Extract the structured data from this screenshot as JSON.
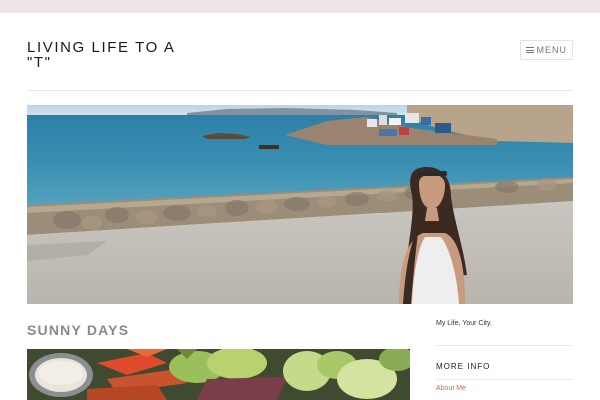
{
  "site": {
    "title": "LIVING LIFE TO A \"T\"",
    "menu_label": "MENU"
  },
  "post": {
    "title": "SUNNY DAYS"
  },
  "sidebar": {
    "tagline": "My Life, Your City.",
    "widget_title": "MORE INFO",
    "links": [
      {
        "label": "About Me"
      }
    ]
  },
  "colors": {
    "top_band": "#efe4e6",
    "link": "#d86a4a",
    "post_title": "#8a8a8a"
  },
  "icons": {
    "menu": "hamburger-icon"
  }
}
